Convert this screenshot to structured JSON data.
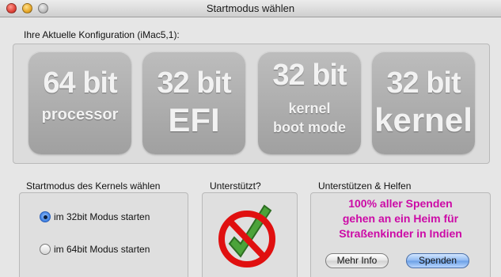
{
  "window": {
    "title": "Startmodus wählen"
  },
  "config": {
    "label": "Ihre Aktuelle Konfiguration (iMac5,1):",
    "tiles": [
      {
        "big": "64 bit",
        "small": "processor"
      },
      {
        "big": "32 bit",
        "med": "EFI"
      },
      {
        "big": "32 bit",
        "line1": "kernel",
        "line2": "boot mode"
      },
      {
        "big": "32 bit",
        "med": "kernel"
      }
    ]
  },
  "kernel_mode": {
    "label": "Startmodus des Kernels wählen",
    "options": [
      {
        "label": "im 32bit Modus starten",
        "selected": true
      },
      {
        "label": "im 64bit Modus starten",
        "selected": false
      }
    ]
  },
  "supported": {
    "label": "Unterstützt?"
  },
  "support_help": {
    "label": "Unterstützen & Helfen",
    "text_lines": [
      "100% aller Spenden",
      "gehen an ein Heim für",
      "Straßenkinder in Indien"
    ],
    "more_info_button": "Mehr Info",
    "donate_button": "Spenden"
  },
  "colors": {
    "donate_text": "#cc0aa6",
    "prohibit_red": "#e01010",
    "check_green": "#4ca33a"
  }
}
